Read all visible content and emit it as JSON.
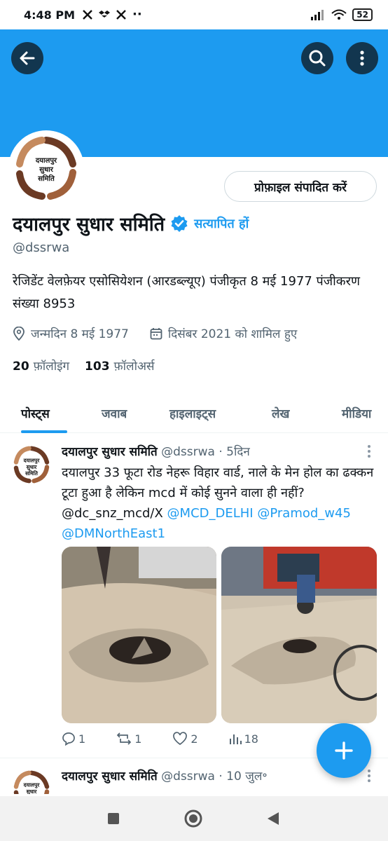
{
  "status_bar": {
    "time": "4:48 PM",
    "battery": "52"
  },
  "profile": {
    "name": "दयालपुर सुधार समिति",
    "verify_text": "सत्यापित हों",
    "handle": "@dssrwa",
    "bio": "रेजिडेंट वेलफ़ेयर एसोसियेशन (आरडब्ल्यूए) पंजीकृत 8 मई 1977 पंजीकरण संख्या 8953",
    "birthday": "जन्मदिन 8 मई 1977",
    "joined": "दिसंबर 2021 को शामिल हुए",
    "following_count": "20",
    "following_label": "फ़ॉलोइंग",
    "followers_count": "103",
    "followers_label": "फ़ॉलोअर्स",
    "edit_button": "प्रोफ़ाइल संपादित करें",
    "avatar_text": [
      "दयालपुर",
      "सुधार",
      "समिति"
    ]
  },
  "tabs": [
    {
      "label": "पोस्ट्स",
      "active": true
    },
    {
      "label": "जवाब"
    },
    {
      "label": "हाइलाइट्स"
    },
    {
      "label": "लेख"
    },
    {
      "label": "मीडिया"
    }
  ],
  "posts": [
    {
      "author": "दयालपुर सुधार समिति",
      "handle": "@dssrwa",
      "separator": "·",
      "time": "5दिन",
      "text": "दयालपुर 33 फूटा रोड नेहरू विहार वार्ड, नाले के मेन होल का ढक्कन टूटा हुआ है लेकिन mcd में कोई सुनने वाला ही नहीं? @dc_snz_mcd/X",
      "mentions": [
        "@MCD_DELHI",
        "@Pramod_w45",
        "@DMNorthEast1"
      ],
      "replies": "1",
      "reposts": "1",
      "likes": "2",
      "views": "18"
    },
    {
      "author": "दयालपुर सुधार समिति",
      "handle": "@dssrwa",
      "separator": "·",
      "time": "10 जुल॰"
    }
  ],
  "colors": {
    "accent": "#1d9bf0",
    "text": "#0f1419",
    "muted": "#536471"
  }
}
